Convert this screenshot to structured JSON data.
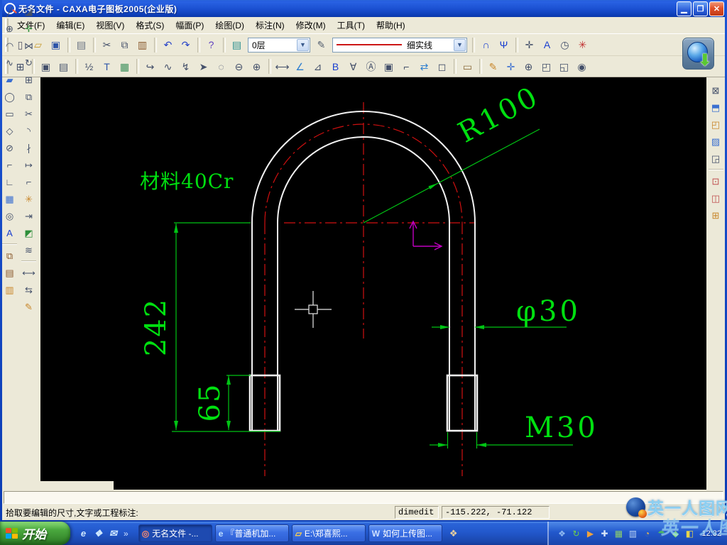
{
  "window": {
    "title": "无名文件 - CAXA电子图板2005(企业版)"
  },
  "titlebar": {
    "minimize": "▁",
    "restore": "❐",
    "close": "✕"
  },
  "menu": [
    {
      "name": "menu-file",
      "label": "文件(F)"
    },
    {
      "name": "menu-edit",
      "label": "编辑(E)"
    },
    {
      "name": "menu-view",
      "label": "视图(V)"
    },
    {
      "name": "menu-format",
      "label": "格式(S)"
    },
    {
      "name": "menu-sheet",
      "label": "幅面(P)"
    },
    {
      "name": "menu-draw",
      "label": "绘图(D)"
    },
    {
      "name": "menu-dim",
      "label": "标注(N)"
    },
    {
      "name": "menu-modify",
      "label": "修改(M)"
    },
    {
      "name": "menu-tools",
      "label": "工具(T)"
    },
    {
      "name": "menu-help",
      "label": "帮助(H)"
    }
  ],
  "toolbar1": {
    "icons_a": [
      {
        "name": "new-button",
        "glyph": "▯",
        "color": "#5a5a6a"
      },
      {
        "name": "open-button",
        "glyph": "▱",
        "color": "#c79a2e"
      },
      {
        "name": "save-button",
        "glyph": "▣",
        "color": "#2e55a8"
      },
      {
        "name": "print-button",
        "glyph": "▤",
        "color": "#667080",
        "gap": true
      },
      {
        "name": "cut-button",
        "glyph": "✂",
        "color": "#44506a",
        "gap": true
      },
      {
        "name": "copy-button",
        "glyph": "⧉",
        "color": "#44506a"
      },
      {
        "name": "paste-button",
        "glyph": "▥",
        "color": "#8a5a2e"
      },
      {
        "name": "undo-button",
        "glyph": "↶",
        "color": "#2340c8",
        "gap": true
      },
      {
        "name": "redo-button",
        "glyph": "↷",
        "color": "#2340c8"
      },
      {
        "name": "help-button",
        "glyph": "?",
        "color": "#6040c0",
        "gap": true
      }
    ],
    "layer_button": {
      "glyph": "▤",
      "color": "#2a8f8f"
    },
    "layer_value": "0层",
    "linestyle_button": {
      "glyph": "✎",
      "color": "#556070"
    },
    "linetype_value": "细实线",
    "icons_b": [
      {
        "name": "snap-button",
        "glyph": "∩",
        "color": "#1a3fd0",
        "gap": true
      },
      {
        "name": "pick-set-button",
        "glyph": "Ψ",
        "color": "#1a3fd0"
      },
      {
        "name": "pan-button",
        "glyph": "✛",
        "color": "#44506a",
        "gap": true
      },
      {
        "name": "select-text-button",
        "glyph": "A",
        "color": "#1a3fd0"
      },
      {
        "name": "history-button",
        "glyph": "◷",
        "color": "#44506a"
      },
      {
        "name": "redraw-button",
        "glyph": "✳",
        "color": "#c03030"
      }
    ]
  },
  "toolbar2": {
    "icons": [
      {
        "name": "zoom-extents-button",
        "glyph": "⊞",
        "color": "#44506a"
      },
      {
        "name": "frame-window-button",
        "glyph": "▣",
        "color": "#44506a",
        "gap": true
      },
      {
        "name": "frame-text-button",
        "glyph": "▤",
        "color": "#44506a"
      },
      {
        "name": "dim-style-button",
        "glyph": "½",
        "color": "#44506a",
        "gap": true
      },
      {
        "name": "table-button",
        "glyph": "T",
        "color": "#2e55a8"
      },
      {
        "name": "image-button",
        "glyph": "▦",
        "color": "#3a8f5a"
      },
      {
        "name": "leader-hook-button",
        "glyph": "↪",
        "color": "#44506a",
        "gap": true
      },
      {
        "name": "leader-wave-button",
        "glyph": "∿",
        "color": "#44506a"
      },
      {
        "name": "leader-zigzag-button",
        "glyph": "↯",
        "color": "#44506a"
      },
      {
        "name": "leader-arrow-button",
        "glyph": "➤",
        "color": "#44506a"
      },
      {
        "name": "leader-cloud-button",
        "glyph": "◌",
        "color": "#44506a"
      },
      {
        "name": "leader-circle-button",
        "glyph": "⊖",
        "color": "#44506a"
      },
      {
        "name": "leader-target-button",
        "glyph": "⊕",
        "color": "#44506a"
      },
      {
        "name": "dim-linear-button",
        "glyph": "⟷",
        "color": "#44506a",
        "gap": true
      },
      {
        "name": "dim-coord-button",
        "glyph": "∠",
        "color": "#2e7fd0"
      },
      {
        "name": "dim-tolerance-button",
        "glyph": "⊿",
        "color": "#44506a"
      },
      {
        "name": "dim-datum-button",
        "glyph": "B",
        "color": "#1a3fd0"
      },
      {
        "name": "dim-surface-button",
        "glyph": "∀",
        "color": "#44506a"
      },
      {
        "name": "dim-balloon-button",
        "glyph": "Ⓐ",
        "color": "#44506a"
      },
      {
        "name": "dim-frame-button",
        "glyph": "▣",
        "color": "#44506a"
      },
      {
        "name": "dim-leader-button",
        "glyph": "⌐",
        "color": "#44506a"
      },
      {
        "name": "dim-edit-button",
        "glyph": "⇄",
        "color": "#2e7fd0"
      },
      {
        "name": "dim-zoom-button",
        "glyph": "◻",
        "color": "#44506a"
      },
      {
        "name": "ruler-button",
        "glyph": "▭",
        "color": "#8a6a3a",
        "gap": true
      },
      {
        "name": "sketch-button",
        "glyph": "✎",
        "color": "#c8862a",
        "gap": true
      },
      {
        "name": "pan-view-button",
        "glyph": "✛",
        "color": "#3a6fd0"
      },
      {
        "name": "zoom-inout-button",
        "glyph": "⊕",
        "color": "#44506a"
      },
      {
        "name": "zoom-window-button",
        "glyph": "◰",
        "color": "#44506a"
      },
      {
        "name": "zoom-page-button",
        "glyph": "◱",
        "color": "#44506a"
      },
      {
        "name": "zoom-dynamic-button",
        "glyph": "◉",
        "color": "#44506a"
      }
    ]
  },
  "left_toolbar": {
    "col1a": [
      {
        "name": "line-tool",
        "glyph": "╱",
        "color": "#44506a"
      },
      {
        "name": "circle-tool",
        "glyph": "⊕",
        "color": "#44506a"
      },
      {
        "name": "arc-tool",
        "glyph": "◠",
        "color": "#44506a"
      },
      {
        "name": "spline-tool",
        "glyph": "∿",
        "color": "#44506a"
      },
      {
        "name": "fill-tool",
        "glyph": "▰",
        "color": "#3a6fd0"
      },
      {
        "name": "ellipse-tool",
        "glyph": "◯",
        "color": "#44506a"
      },
      {
        "name": "rectangle-tool",
        "glyph": "▭",
        "color": "#44506a"
      },
      {
        "name": "polygon-tool",
        "glyph": "◇",
        "color": "#44506a"
      },
      {
        "name": "pen-tool",
        "glyph": "⊘",
        "color": "#44506a"
      },
      {
        "name": "polyline-tool",
        "glyph": "⌐",
        "color": "#44506a"
      },
      {
        "name": "axis-tool",
        "glyph": "∟",
        "color": "#44506a"
      },
      {
        "name": "hatch-tool",
        "glyph": "▦",
        "color": "#3a6fd0"
      },
      {
        "name": "contour-tool",
        "glyph": "◎",
        "color": "#44506a"
      },
      {
        "name": "text-tool",
        "glyph": "A",
        "color": "#1a3fd0"
      }
    ],
    "col1b": [
      {
        "name": "block-create-tool",
        "glyph": "⧉",
        "color": "#8a5a2e"
      },
      {
        "name": "block-attrib-tool",
        "glyph": "▤",
        "color": "#8a5a2e"
      },
      {
        "name": "block-edit-tool",
        "glyph": "▥",
        "color": "#c8862a"
      }
    ],
    "col2a": [
      {
        "name": "erase-tool",
        "glyph": "◪",
        "color": "#44506a"
      },
      {
        "name": "move-tool",
        "glyph": "✛",
        "color": "#2e8f3a"
      },
      {
        "name": "mirror-tool",
        "glyph": "⋈",
        "color": "#44506a"
      },
      {
        "name": "rotate-tool",
        "glyph": "↻",
        "color": "#44506a"
      },
      {
        "name": "array-tool",
        "glyph": "⊞",
        "color": "#44506a"
      },
      {
        "name": "copy-tool",
        "glyph": "⧉",
        "color": "#44506a"
      },
      {
        "name": "trim-tool",
        "glyph": "✂",
        "color": "#44506a"
      },
      {
        "name": "fillet-tool",
        "glyph": "◝",
        "color": "#44506a"
      },
      {
        "name": "break-tool",
        "glyph": "∤",
        "color": "#44506a"
      },
      {
        "name": "extend-tool",
        "glyph": "↦",
        "color": "#44506a"
      },
      {
        "name": "corner-tool",
        "glyph": "⌐",
        "color": "#44506a"
      },
      {
        "name": "explode-tool",
        "glyph": "✳",
        "color": "#c8862a"
      },
      {
        "name": "stretch-tool",
        "glyph": "⇥",
        "color": "#44506a"
      },
      {
        "name": "block-move-tool",
        "glyph": "◩",
        "color": "#2e8f3a"
      },
      {
        "name": "offset-tool",
        "glyph": "≋",
        "color": "#44506a"
      }
    ],
    "col2b": [
      {
        "name": "dim-tool",
        "glyph": "⟷",
        "color": "#44506a"
      },
      {
        "name": "dim-quick-tool",
        "glyph": "⇆",
        "color": "#44506a"
      },
      {
        "name": "style-brush-tool",
        "glyph": "✎",
        "color": "#c8862a"
      }
    ]
  },
  "right_toolbar": {
    "a": [
      {
        "name": "lib-delete-button",
        "glyph": "⊠",
        "color": "#44506a"
      },
      {
        "name": "lib-3d-button",
        "glyph": "⬒",
        "color": "#3a6fd0"
      },
      {
        "name": "lib-export-button",
        "glyph": "◰",
        "color": "#c8862a"
      },
      {
        "name": "lib-render-button",
        "glyph": "▨",
        "color": "#3a6fd0"
      },
      {
        "name": "lib-edit-button",
        "glyph": "◲",
        "color": "#44506a"
      }
    ],
    "b": [
      {
        "name": "lib-ole-button",
        "glyph": "⊡",
        "color": "#c05050"
      },
      {
        "name": "lib-image-button",
        "glyph": "◫",
        "color": "#c05050"
      },
      {
        "name": "lib-update-button",
        "glyph": "⊞",
        "color": "#c8862a"
      }
    ]
  },
  "canvas": {
    "material_note": "材料40Cr",
    "dim_radius": "R100",
    "dim_height": "242",
    "dim_thread_len": "65",
    "dim_diameter": "φ30",
    "dim_thread": "M30"
  },
  "cmdline": {
    "value": ""
  },
  "statusbar": {
    "message": "拾取要编辑的尺寸,文字或工程标注:",
    "command": "dimedit",
    "coords": "-115.222, -71.122"
  },
  "taskbar": {
    "start": "开始",
    "quick": [
      {
        "name": "quicklaunch-ie",
        "glyph": "e",
        "color": "#cfe8ff"
      },
      {
        "name": "quicklaunch-desktop",
        "glyph": "❖",
        "color": "#cfe8ff"
      },
      {
        "name": "quicklaunch-mail",
        "glyph": "✉",
        "color": "#cfe8ff"
      }
    ],
    "chevron": "»",
    "tasks": [
      {
        "name": "task-caxa",
        "label": "无名文件 -...",
        "glyph": "◎",
        "color": "#ff8a6a",
        "active": true
      },
      {
        "name": "task-ie",
        "label": "『普通机加...",
        "glyph": "e",
        "color": "#bfe0ff"
      },
      {
        "name": "task-folder",
        "label": "E:\\郑喜熙...",
        "glyph": "▱",
        "color": "#ffd24a"
      },
      {
        "name": "task-word",
        "label": "如何上传图...",
        "glyph": "W",
        "color": "#cfe0ff"
      }
    ],
    "badge": {
      "glyph": "❖",
      "color": "#e8b64a"
    },
    "tray": [
      {
        "name": "tray-messenger",
        "glyph": "❖",
        "color": "#8fb8f0"
      },
      {
        "name": "tray-updater",
        "glyph": "↻",
        "color": "#6fd04a"
      },
      {
        "name": "tray-player",
        "glyph": "▶",
        "color": "#f0a23c"
      },
      {
        "name": "tray-shield",
        "glyph": "✚",
        "color": "#d8e6f8"
      },
      {
        "name": "tray-display",
        "glyph": "▦",
        "color": "#8fd06a"
      },
      {
        "name": "tray-film",
        "glyph": "▥",
        "color": "#bcd4f4"
      },
      {
        "name": "tray-browser",
        "glyph": "◔",
        "color": "#e8b64a"
      },
      {
        "name": "tray-umbrella",
        "glyph": "☂",
        "color": "#4ab368"
      },
      {
        "name": "tray-guard",
        "glyph": "◆",
        "color": "#7ed780"
      },
      {
        "name": "tray-volume",
        "glyph": "◧",
        "color": "#e8d44a"
      }
    ],
    "clock": "12:32"
  },
  "watermark": {
    "text": "英一人图网"
  }
}
